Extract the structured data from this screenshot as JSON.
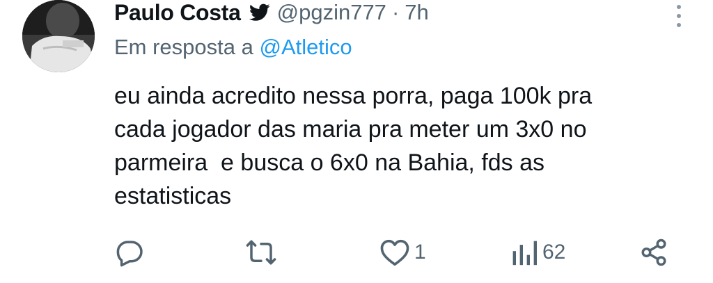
{
  "tweet": {
    "author": {
      "display_name": "Paulo Costa",
      "handle": "@pgzin777",
      "separator": "·",
      "time": "7h",
      "avatar_icon": "profile-photo",
      "verified_icon": "twitter-bird-icon"
    },
    "reply": {
      "prefix": "Em resposta a",
      "mention": "@Atletico"
    },
    "text_lines": [
      "eu ainda acredito nessa porra, paga 100k pra",
      "cada jogador das maria pra meter um 3x0 no",
      "parmeira  e busca o 6x0 na Bahia, fds as",
      "estatisticas"
    ],
    "actions": {
      "reply_icon": "speech-bubble-icon",
      "retweet_icon": "retweet-icon",
      "like_icon": "heart-icon",
      "like_count": "1",
      "views_icon": "bar-chart-icon",
      "views_count": "62",
      "share_icon": "share-icon"
    },
    "colors": {
      "text": "#0f1419",
      "secondary": "#536471",
      "accent": "#1d9bf0"
    }
  }
}
